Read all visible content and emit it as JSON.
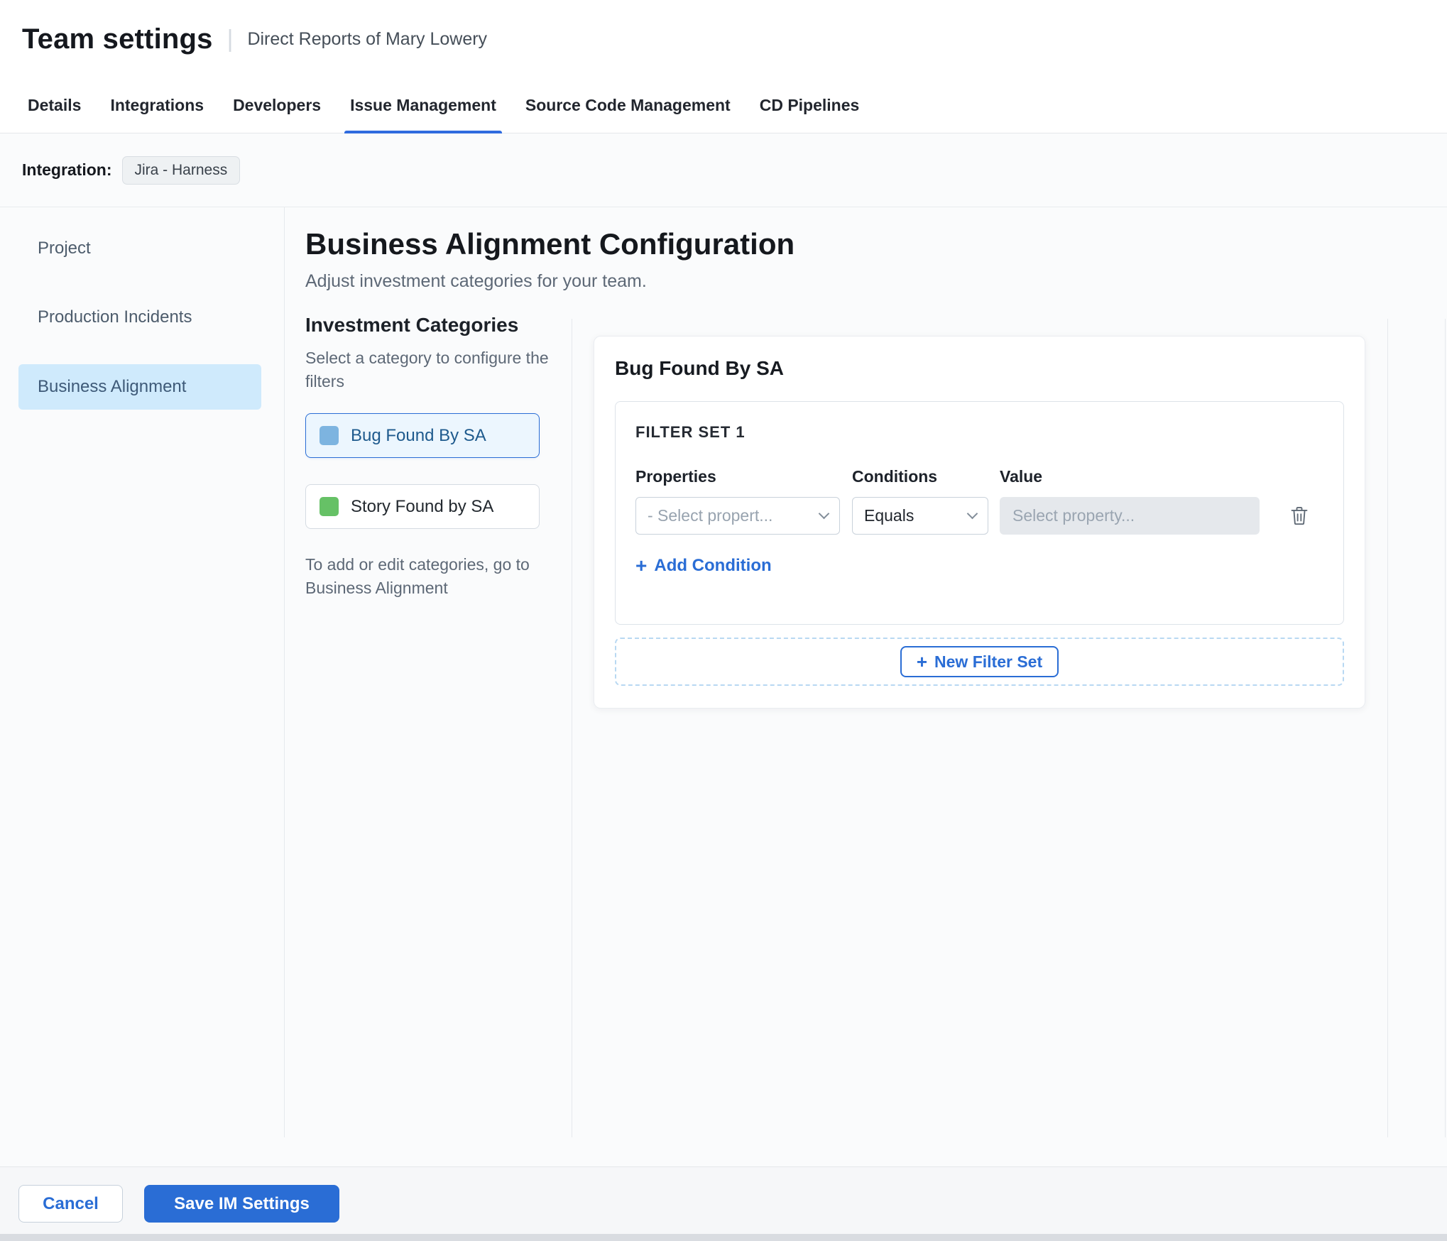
{
  "header": {
    "title": "Team settings",
    "separator": "|",
    "subtitle": "Direct Reports of Mary Lowery"
  },
  "tabs": [
    {
      "label": "Details",
      "active": false
    },
    {
      "label": "Integrations",
      "active": false
    },
    {
      "label": "Developers",
      "active": false
    },
    {
      "label": "Issue Management",
      "active": true
    },
    {
      "label": "Source Code Management",
      "active": false
    },
    {
      "label": "CD Pipelines",
      "active": false
    }
  ],
  "integration": {
    "label": "Integration:",
    "value": "Jira - Harness"
  },
  "sidebar": {
    "items": [
      {
        "label": "Project",
        "selected": false
      },
      {
        "label": "Production Incidents",
        "selected": false
      },
      {
        "label": "Business Alignment",
        "selected": true
      }
    ]
  },
  "main": {
    "title": "Business Alignment Configuration",
    "subtitle": "Adjust investment categories for your team.",
    "categories": {
      "heading": "Investment Categories",
      "helper": "Select a category to configure the filters",
      "items": [
        {
          "label": "Bug Found By SA",
          "selected": true
        },
        {
          "label": "Story Found by SA",
          "selected": false
        }
      ],
      "footnote": "To add or edit categories, go to Business Alignment"
    },
    "panel": {
      "title": "Bug Found By SA",
      "filter_set": {
        "title": "FILTER SET 1",
        "columns": [
          "Properties",
          "Conditions",
          "Value"
        ],
        "property_placeholder": "- Select propert...",
        "condition_value": "Equals",
        "value_placeholder": "Select property...",
        "add_condition_label": "Add Condition"
      },
      "new_filter_set_label": "New Filter Set"
    }
  },
  "footer": {
    "cancel_label": "Cancel",
    "save_label": "Save IM Settings"
  },
  "icons": {
    "plus": "+"
  },
  "colors": {
    "accent_blue": "#2a6dd5",
    "tab_underline": "#2f6bdf",
    "selected_nav_bg": "#cfeafc",
    "selected_category_bg": "#ecf6fe",
    "category_bug_swatch": "#7db4e0",
    "category_story_swatch": "#66c166",
    "save_button_bg": "#2a6dd5",
    "disabled_input_bg": "#e5e8ec"
  }
}
